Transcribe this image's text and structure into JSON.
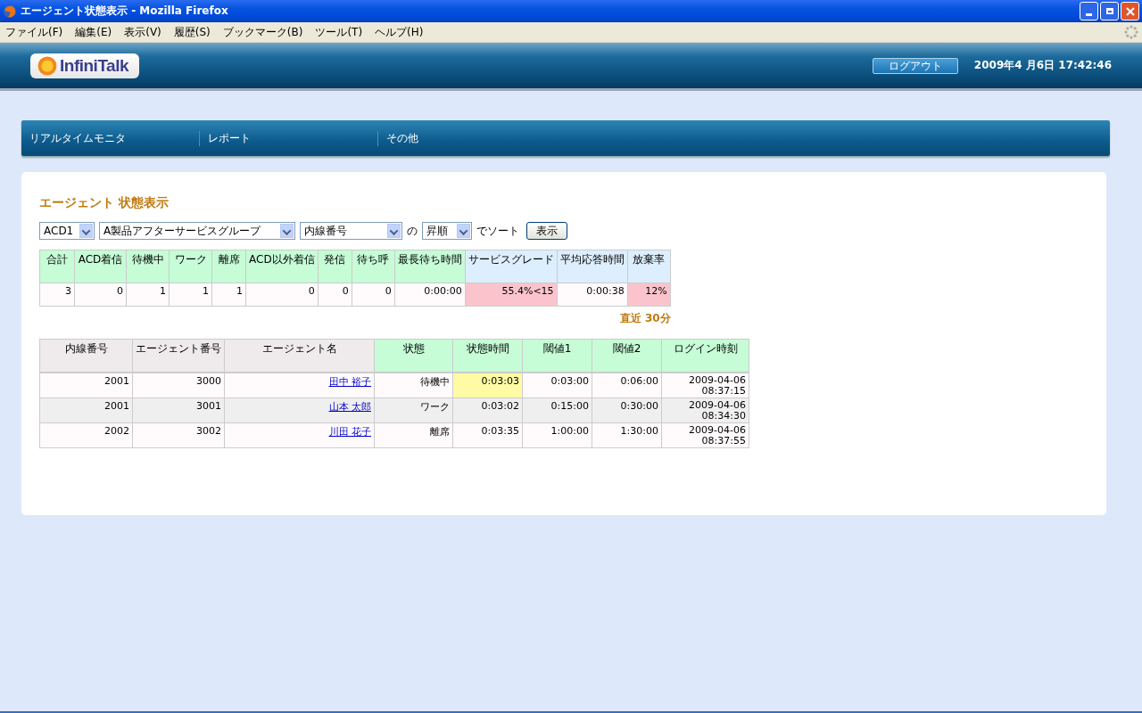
{
  "window": {
    "title": "エージェント状態表示 - Mozilla Firefox"
  },
  "menu": [
    "ファイル(F)",
    "編集(E)",
    "表示(V)",
    "履歴(S)",
    "ブックマーク(B)",
    "ツール(T)",
    "ヘルプ(H)"
  ],
  "header": {
    "logo": "InfiniTalk",
    "logout": "ログアウト",
    "datetime": "2009年4 月6日 17:42:46"
  },
  "nav": [
    "リアルタイムモニタ",
    "レポート",
    "その他"
  ],
  "page_title": "エージェント 状態表示",
  "filters": {
    "acd": "ACD1",
    "group": "A製品アフターサービスグループ",
    "sort_key": "内線番号",
    "of": "の",
    "order": "昇順",
    "sort_label": "でソート",
    "submit": "表示"
  },
  "summary": {
    "columns": [
      {
        "label": "合計",
        "color": "#c6fcd6"
      },
      {
        "label": "ACD着信",
        "color": "#c6fcd6"
      },
      {
        "label": "待機中",
        "color": "#c6fcd6"
      },
      {
        "label": "ワーク",
        "color": "#c6fcd6"
      },
      {
        "label": "離席",
        "color": "#c6fcd6"
      },
      {
        "label": "ACD以外着信",
        "color": "#c6fcd6"
      },
      {
        "label": "発信",
        "color": "#c6fcd6"
      },
      {
        "label": "待ち呼",
        "color": "#c6fcd6"
      },
      {
        "label": "最長待ち時間",
        "color": "#c6fcd6"
      },
      {
        "label": "サービスグレード",
        "color": "#ddeefe"
      },
      {
        "label": "平均応答時間",
        "color": "#ddeefe"
      },
      {
        "label": "放棄率",
        "color": "#ddeefe"
      }
    ],
    "values": [
      {
        "text": "3",
        "alert": false
      },
      {
        "text": "0",
        "alert": false
      },
      {
        "text": "1",
        "alert": false
      },
      {
        "text": "1",
        "alert": false
      },
      {
        "text": "1",
        "alert": false
      },
      {
        "text": "0",
        "alert": false
      },
      {
        "text": "0",
        "alert": false
      },
      {
        "text": "0",
        "alert": false
      },
      {
        "text": "0:00:00",
        "alert": false
      },
      {
        "text": "55.4%<15",
        "alert": true
      },
      {
        "text": "0:00:38",
        "alert": false
      },
      {
        "text": "12%",
        "alert": true
      }
    ],
    "period": "直近 30分"
  },
  "agents": {
    "columns": [
      {
        "label": "内線番号",
        "color": "#efeaec"
      },
      {
        "label": "エージェント番号",
        "color": "#efeaec"
      },
      {
        "label": "エージェント名",
        "color": "#efeaec"
      },
      {
        "label": "状態",
        "color": "#c6fcd6"
      },
      {
        "label": "状態時間",
        "color": "#c6fcd6"
      },
      {
        "label": "閾値1",
        "color": "#c6fcd6"
      },
      {
        "label": "閾値2",
        "color": "#c6fcd6"
      },
      {
        "label": "ログイン時刻",
        "color": "#c6fcd6"
      }
    ],
    "rows": [
      {
        "extension": "2001",
        "agent_no": "3000",
        "name": "田中 裕子",
        "state": "待機中",
        "state_time": "0:03:03",
        "over_threshold": true,
        "threshold1": "0:03:00",
        "threshold2": "0:06:00",
        "login_date": "2009-04-06",
        "login_time": "08:37:15"
      },
      {
        "extension": "2001",
        "agent_no": "3001",
        "name": "山本 太郎",
        "state": "ワーク",
        "state_time": "0:03:02",
        "over_threshold": false,
        "threshold1": "0:15:00",
        "threshold2": "0:30:00",
        "login_date": "2009-04-06",
        "login_time": "08:34:30"
      },
      {
        "extension": "2002",
        "agent_no": "3002",
        "name": "川田 花子",
        "state": "離席",
        "state_time": "0:03:35",
        "over_threshold": false,
        "threshold1": "1:00:00",
        "threshold2": "1:30:00",
        "login_date": "2009-04-06",
        "login_time": "08:37:55"
      }
    ]
  }
}
